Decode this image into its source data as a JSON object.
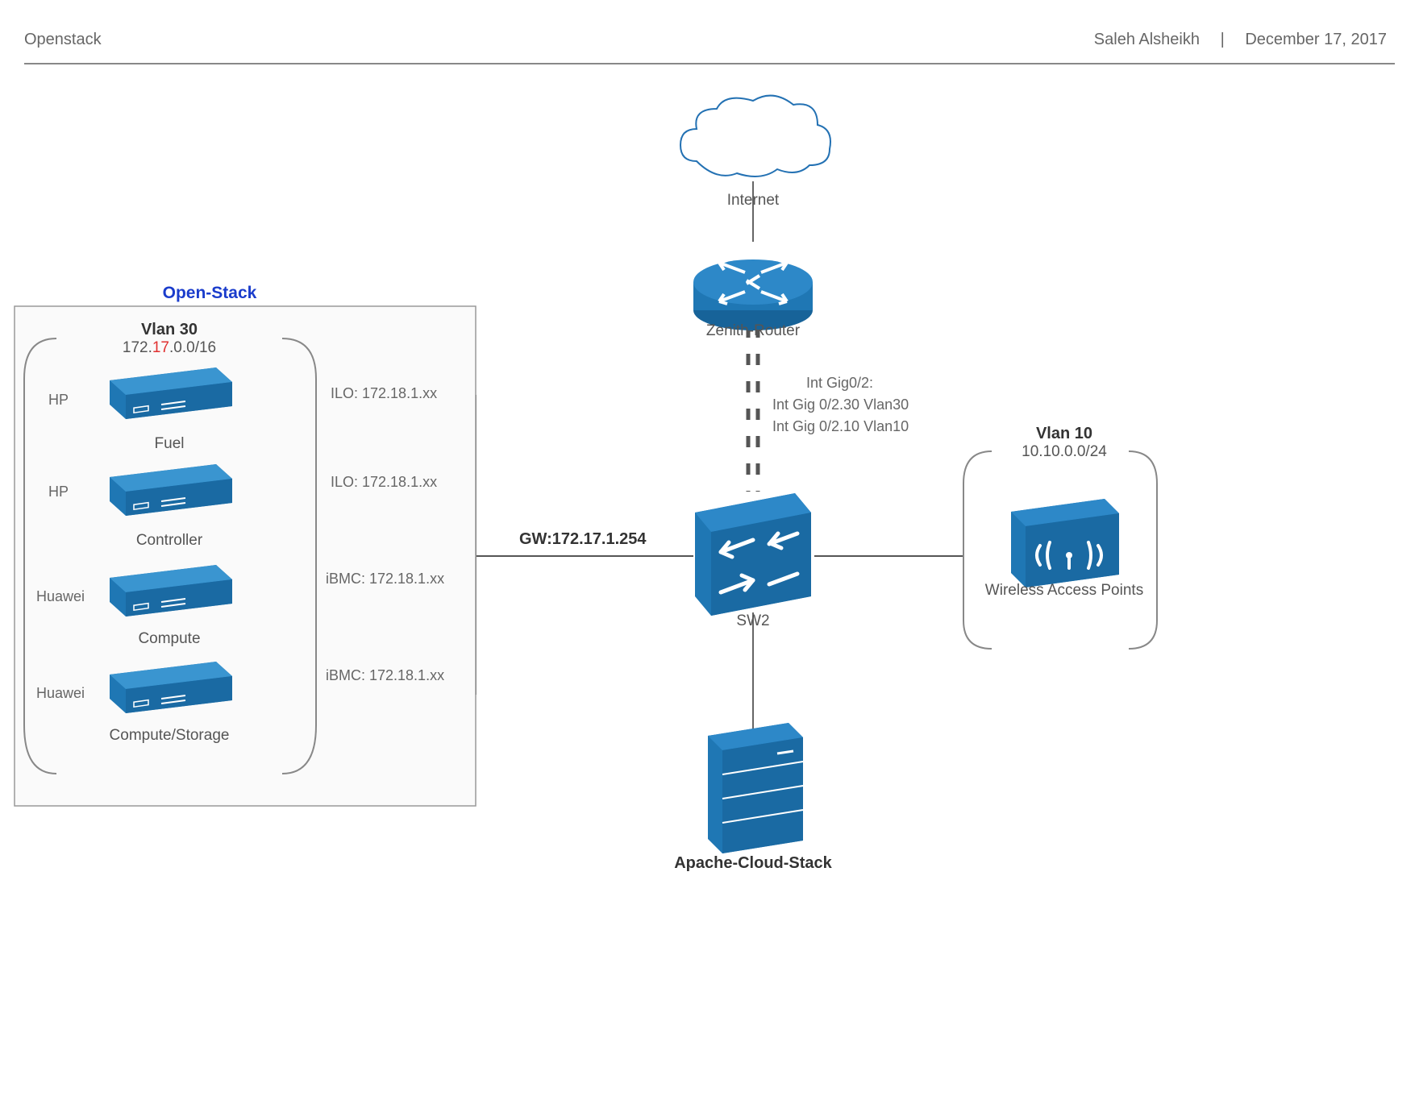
{
  "header": {
    "title": "Openstack",
    "author": "Saleh Alsheikh",
    "sep": "|",
    "date": "December 17, 2017"
  },
  "openstack": {
    "title": "Open-Stack",
    "vlan_title": "Vlan 30",
    "subnet_prefix": "172.",
    "subnet_red": "17",
    "subnet_suffix": ".0.0/16",
    "servers": [
      {
        "vendor": "HP",
        "name": "Fuel",
        "mgmt": "ILO: 172.18.1.xx"
      },
      {
        "vendor": "HP",
        "name": "Controller",
        "mgmt": "ILO: 172.18.1.xx"
      },
      {
        "vendor": "Huawei",
        "name": "Compute",
        "mgmt": "iBMC: 172.18.1.xx"
      },
      {
        "vendor": "Huawei",
        "name": "Compute/Storage",
        "mgmt": "iBMC: 172.18.1.xx"
      }
    ]
  },
  "gateway": "GW:172.17.1.254",
  "internet": "Internet",
  "router": "Zenith-Router",
  "router_iface": {
    "line1": "Int Gig0/2:",
    "line2": "Int Gig 0/2.30 Vlan30",
    "line3": "Int Gig 0/2.10 Vlan10"
  },
  "switch": "SW2",
  "apache": "Apache-Cloud-Stack",
  "wap": {
    "vlan": "Vlan 10",
    "subnet": "10.10.0.0/24",
    "name": "Wireless Access Points"
  }
}
